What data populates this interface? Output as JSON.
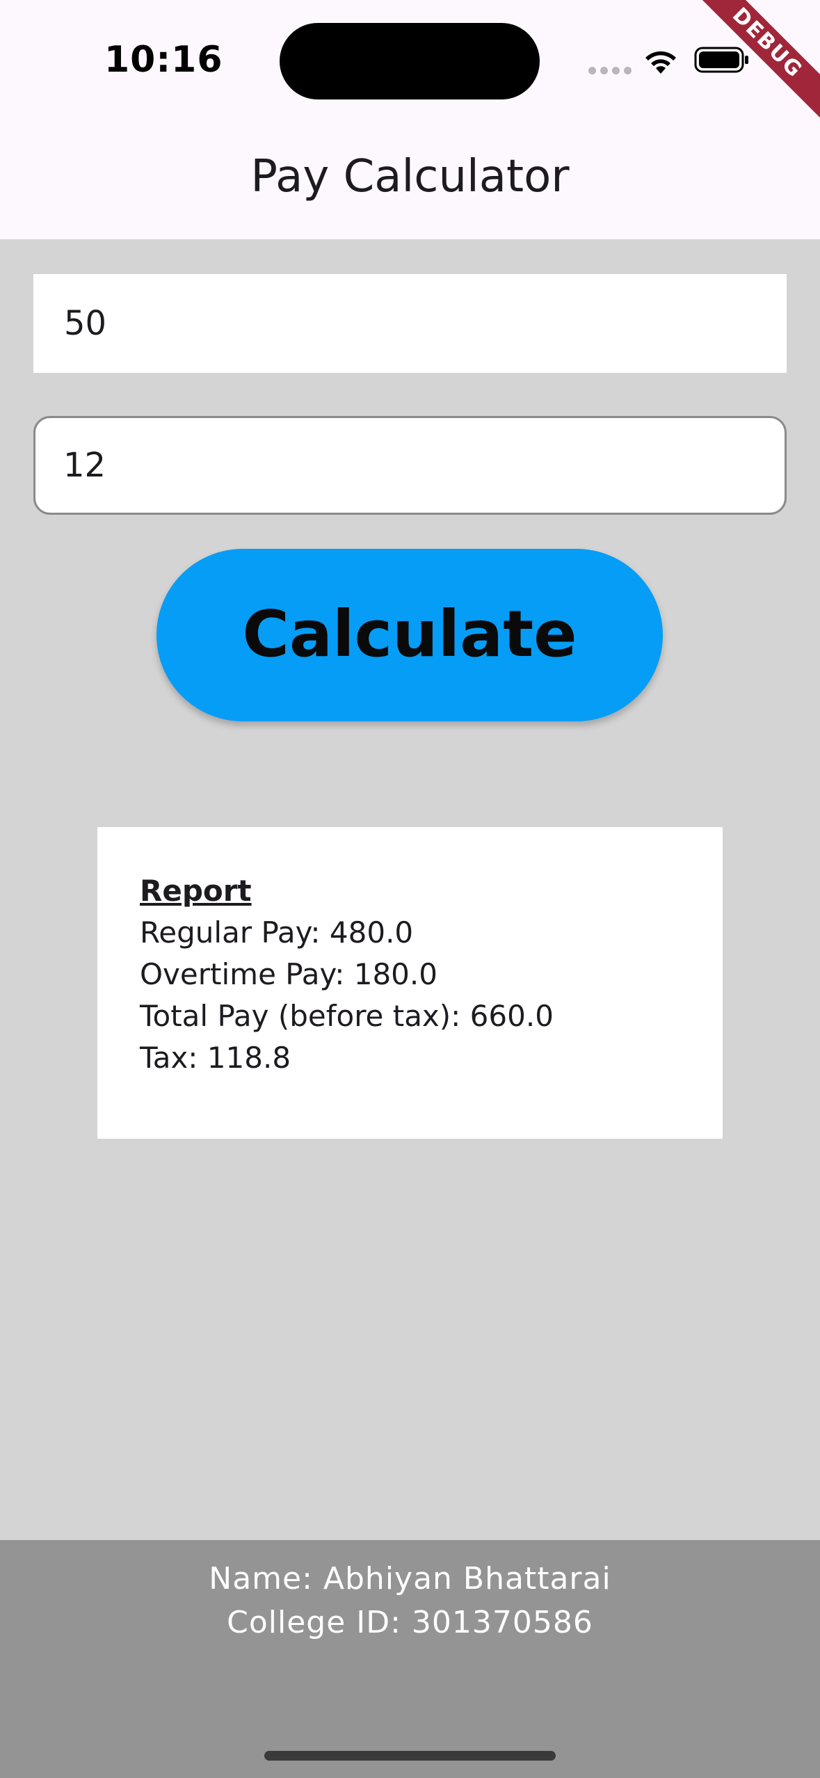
{
  "status_bar": {
    "time": "10:16",
    "icons": [
      "signal-dots-icon",
      "wifi-icon",
      "battery-icon"
    ]
  },
  "debug_banner": "DEBUG",
  "app_bar": {
    "title": "Pay Calculator"
  },
  "form": {
    "hours_value": "50",
    "rate_value": "12",
    "calculate_label": "Calculate"
  },
  "report": {
    "title": "Report",
    "regular_pay": "Regular Pay: 480.0",
    "overtime_pay": "Overtime Pay: 180.0",
    "total_pay": "Total Pay (before tax): 660.0",
    "tax": "Tax: 118.8"
  },
  "footer": {
    "name": "Name: Abhiyan Bhattarai",
    "college_id": "College ID: 301370586"
  },
  "colors": {
    "button": "#069df6",
    "background": "#d4d4d4",
    "footer": "#949494",
    "app_bar": "#fdf8fd"
  }
}
